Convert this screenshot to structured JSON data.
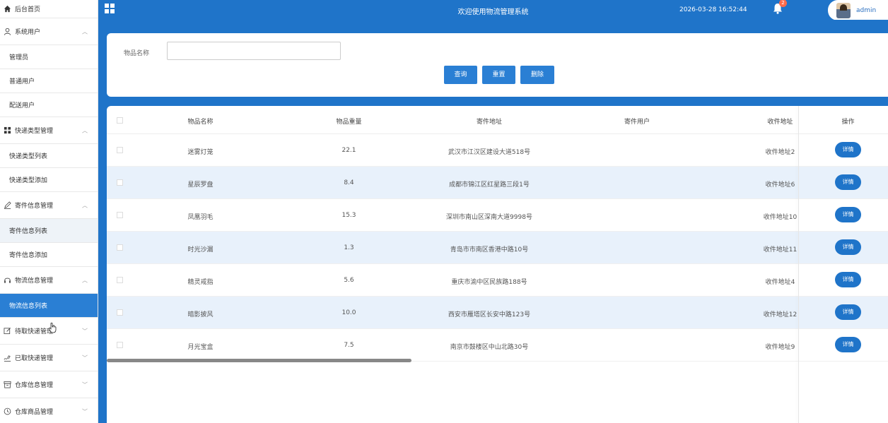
{
  "sidebar": {
    "home": "后台首页",
    "groups": [
      {
        "label": "系统用户",
        "icon": "user-icon",
        "items": [
          "管理员",
          "普通用户",
          "配送用户"
        ]
      },
      {
        "label": "快递类型管理",
        "icon": "grid-icon",
        "items": [
          "快递类型列表",
          "快递类型添加"
        ]
      },
      {
        "label": "寄件信息管理",
        "icon": "pen-icon",
        "items": [
          "寄件信息列表",
          "寄件信息添加"
        ]
      },
      {
        "label": "物流信息管理",
        "icon": "headset-icon",
        "items": [
          "物流信息列表"
        ]
      },
      {
        "label": "待取快递管理",
        "icon": "edit-icon"
      },
      {
        "label": "已取快递管理",
        "icon": "signature-icon"
      },
      {
        "label": "仓库信息管理",
        "icon": "box-icon"
      },
      {
        "label": "仓库商品管理",
        "icon": "clock-icon"
      }
    ]
  },
  "header": {
    "title": "欢迎使用物流管理系统",
    "datetime": "2026-03-28 16:52:44",
    "notification_count": "2",
    "username": "admin"
  },
  "search": {
    "label": "物品名称",
    "value": "",
    "buttons": {
      "query": "查询",
      "reset": "重置",
      "delete": "删除"
    }
  },
  "table": {
    "columns": [
      "物品名称",
      "物品重量",
      "寄件地址",
      "寄件用户",
      "收件地址",
      "操作"
    ],
    "rows": [
      {
        "name": "迷雾灯笼",
        "weight": "22.1",
        "address": "武汉市江汉区建设大道518号",
        "sender": "",
        "receiver": "收件地址2",
        "op": "详情"
      },
      {
        "name": "星辰罗盘",
        "weight": "8.4",
        "address": "成都市锦江区红星路三段1号",
        "sender": "",
        "receiver": "收件地址6",
        "op": "详情"
      },
      {
        "name": "凤凰羽毛",
        "weight": "15.3",
        "address": "深圳市南山区深南大道9998号",
        "sender": "",
        "receiver": "收件地址10",
        "op": "详情"
      },
      {
        "name": "时光沙漏",
        "weight": "1.3",
        "address": "青岛市市南区香港中路10号",
        "sender": "",
        "receiver": "收件地址11",
        "op": "详情"
      },
      {
        "name": "精灵戒指",
        "weight": "5.6",
        "address": "重庆市渝中区民族路188号",
        "sender": "",
        "receiver": "收件地址4",
        "op": "详情"
      },
      {
        "name": "暗影披风",
        "weight": "10.0",
        "address": "西安市雁塔区长安中路123号",
        "sender": "",
        "receiver": "收件地址12",
        "op": "详情"
      },
      {
        "name": "月光宝盒",
        "weight": "7.5",
        "address": "南京市鼓楼区中山北路30号",
        "sender": "",
        "receiver": "收件地址9",
        "op": "详情"
      }
    ]
  },
  "colors": {
    "primary": "#1f74c9",
    "accent": "#2a7fd4",
    "row_alt": "#e8f1fb"
  }
}
